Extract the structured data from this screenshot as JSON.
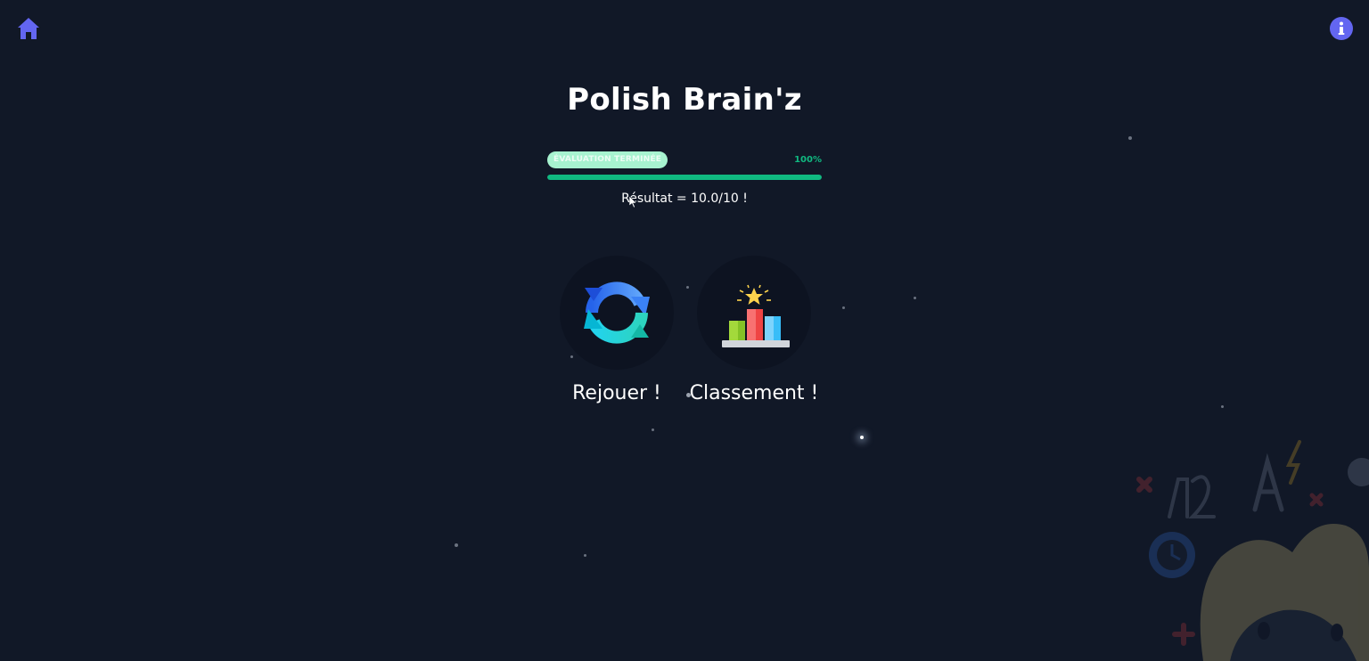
{
  "app": {
    "title": "Polish Brain'z"
  },
  "nav": {
    "home_icon": "home-icon",
    "info_icon": "info-icon"
  },
  "progress": {
    "badge": "ÉVALUATION TERMINÉE",
    "percent_label": "100%",
    "value": 1.0
  },
  "result": {
    "text": "Résultat = 10.0/10 !"
  },
  "actions": {
    "replay": {
      "label": "Rejouer !",
      "icon": "refresh-icon"
    },
    "ranking": {
      "label": "Classement !",
      "icon": "leaderboard-icon"
    }
  },
  "colors": {
    "background": "#111827",
    "accent": "#10b981",
    "badge": "#a7f3d0",
    "nav_icon": "#6366f1"
  }
}
